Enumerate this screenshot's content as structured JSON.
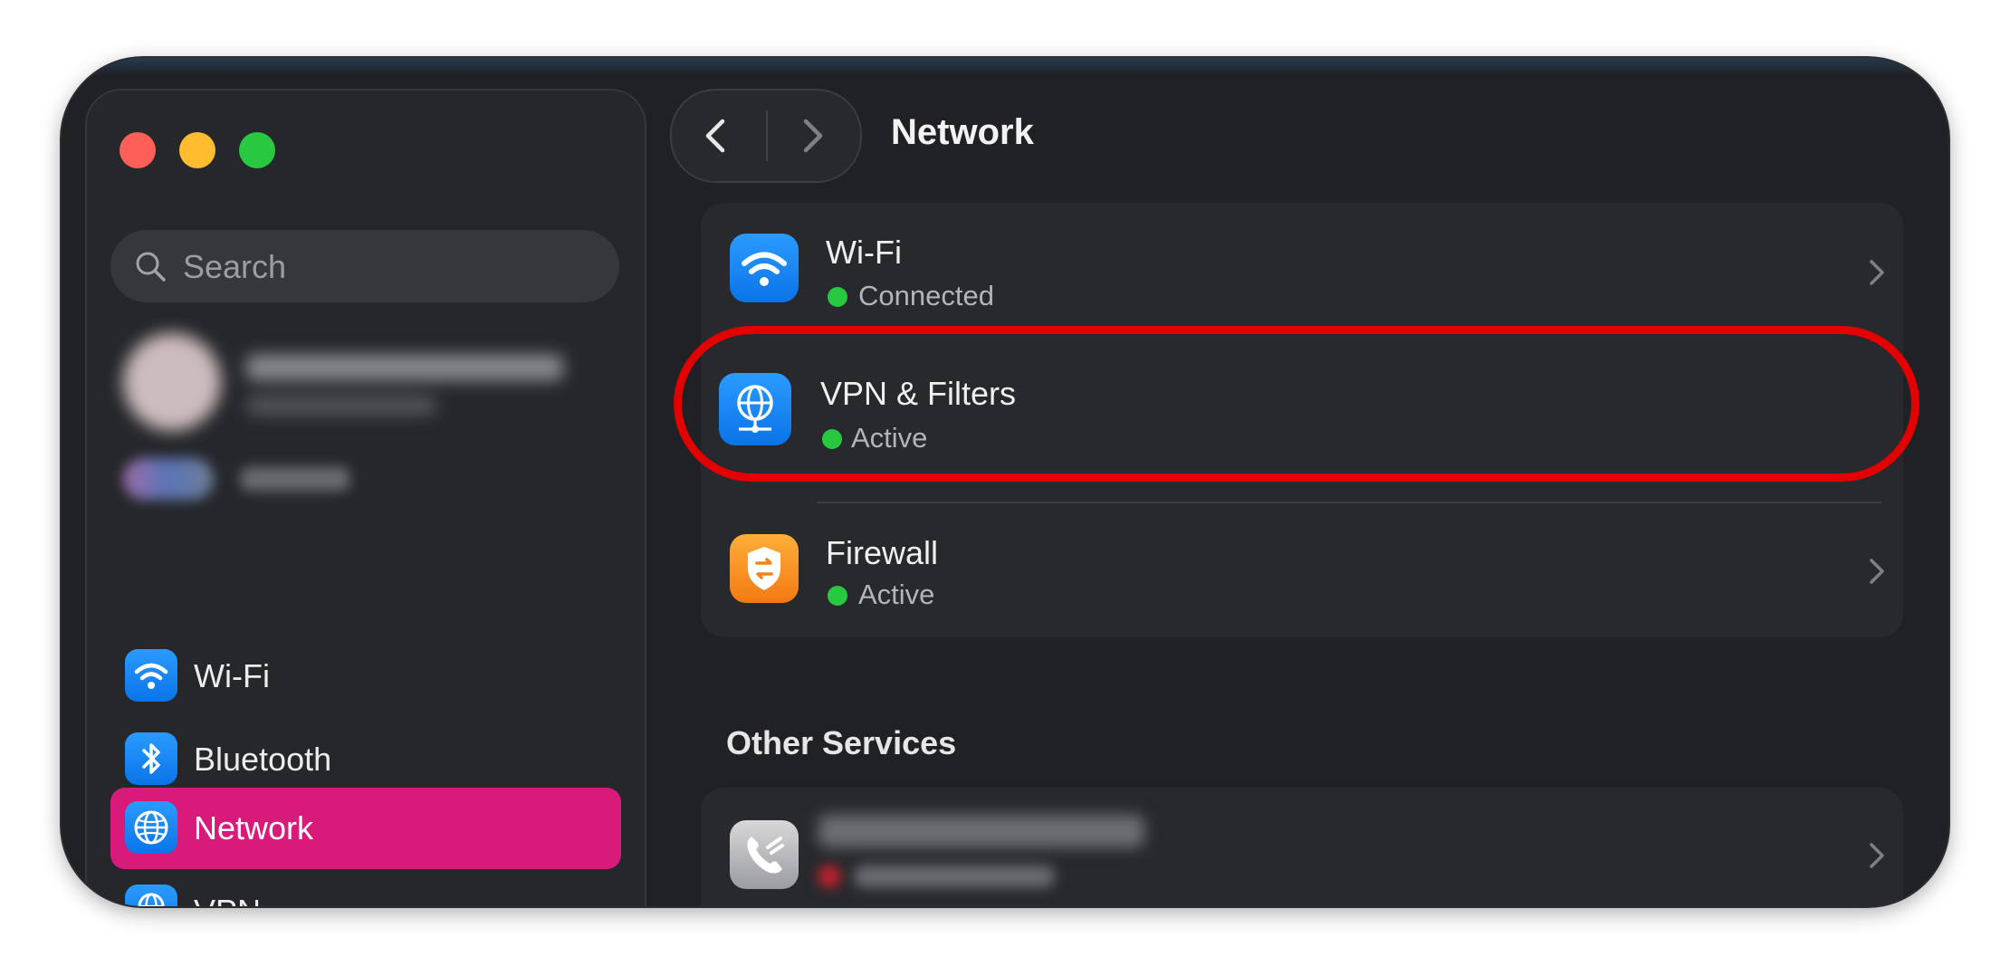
{
  "window": {
    "traffic_lights": [
      "close",
      "minimize",
      "zoom"
    ]
  },
  "sidebar": {
    "search_placeholder": "Search",
    "items": [
      {
        "label": "Wi-Fi",
        "icon": "wifi-icon"
      },
      {
        "label": "Bluetooth",
        "icon": "bluetooth-icon"
      },
      {
        "label": "Network",
        "icon": "globe-icon",
        "selected": true
      },
      {
        "label": "VPN",
        "icon": "vpn-globe-icon"
      }
    ]
  },
  "toolbar": {
    "title": "Network"
  },
  "main": {
    "rows": [
      {
        "title": "Wi-Fi",
        "status": "Connected",
        "status_color": "#28c840",
        "icon": "wifi-icon"
      },
      {
        "title": "VPN & Filters",
        "status": "Active",
        "status_color": "#28c840",
        "icon": "vpn-globe-icon",
        "highlighted": true
      },
      {
        "title": "Firewall",
        "status": "Active",
        "status_color": "#28c840",
        "icon": "firewall-shield-icon"
      }
    ],
    "other_services_title": "Other Services"
  },
  "colors": {
    "selected_sidebar": "#d81b7a",
    "highlight_ring": "#e20000",
    "status_green": "#28c840"
  }
}
